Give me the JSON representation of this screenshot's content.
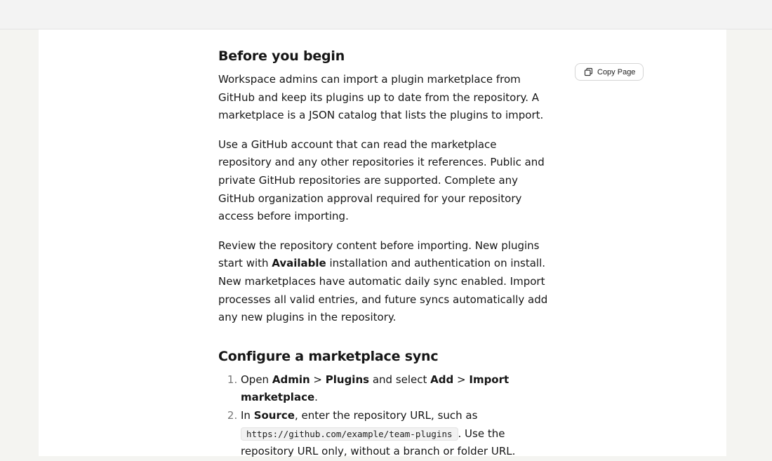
{
  "page": {
    "copy_button_label": "Copy Page",
    "icon_copy": "copy-icon"
  },
  "section_before": {
    "title": "Before you begin",
    "p1": "Workspace admins can import a plugin marketplace from GitHub and keep its plugins up to date from the repository. A marketplace is a JSON catalog that lists the plugins to import.",
    "p2": "Use a GitHub account that can read the marketplace repository and any other repositories it references. Public and private GitHub repositories are supported. Complete any GitHub organization approval required for your repository access before importing.",
    "p3": {
      "before": "Review the repository content before importing. New plugins start with ",
      "bold": "Available",
      "after": " installation and authentication on install. New marketplaces have automatic daily sync enabled. Import processes all valid entries, and future syncs automatically add any new plugins in the repository."
    }
  },
  "section_configure": {
    "title": "Configure a marketplace sync",
    "step1": {
      "open": "Open ",
      "admin": "Admin",
      "gt1": " > ",
      "plugins": "Plugins",
      "and_select": " and select ",
      "add": "Add",
      "gt2": " > ",
      "import": "Import marketplace",
      "end": "."
    },
    "step2": {
      "in": "In ",
      "source": "Source",
      "text": ", enter the repository URL, such as",
      "code": "https://github.com/example/team-plugins",
      "after": ". Use the repository URL only, without a branch or folder URL."
    }
  }
}
